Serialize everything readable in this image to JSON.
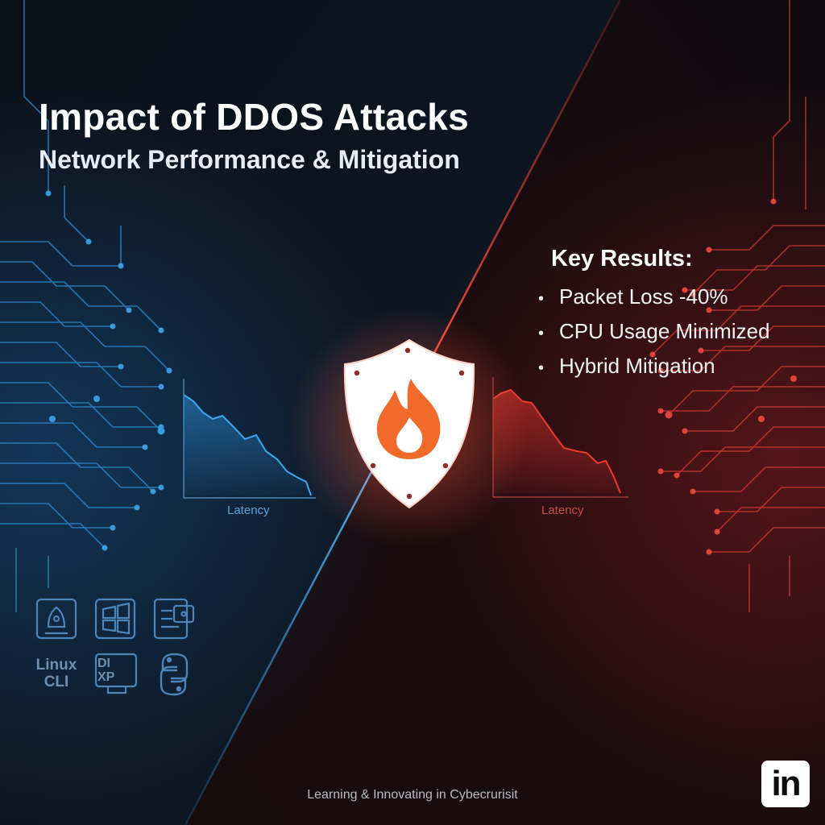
{
  "header": {
    "title": "Impact of DDOS Attacks",
    "subtitle": "Network Performance & Mitigation"
  },
  "key_results": {
    "title": "Key Results:",
    "items": [
      "Packet Loss -40%",
      "CPU Usage Minimized",
      "Hybrid Mitigation"
    ]
  },
  "charts": {
    "left_label": "Latency",
    "right_label": "Latency"
  },
  "icons": {
    "shield": "shield-flame-icon",
    "linux_label": "Linux\nCLI",
    "xp_label": "DI\nXP",
    "python": "python-icon"
  },
  "footer": {
    "text": "Learning & Innovating in Cybecrurisit"
  },
  "branding": {
    "linkedin": "in"
  },
  "colors": {
    "blue_accent": "#2f9be0",
    "red_accent": "#e03a34",
    "flame": "#f26a2b",
    "background": "#0b0d13"
  }
}
